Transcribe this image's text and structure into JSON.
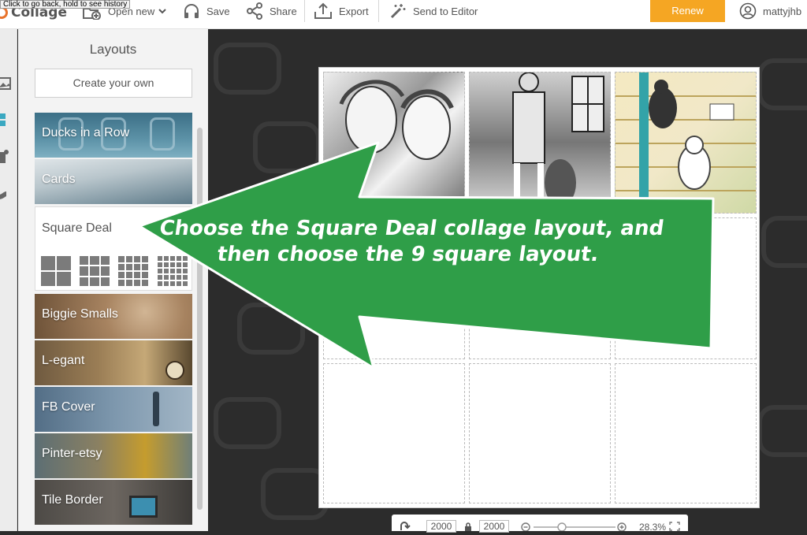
{
  "tooltip": "Click to go back, hold to see history",
  "app": {
    "logo_text": "Collage"
  },
  "toolbar": {
    "open_new": "Open new",
    "save": "Save",
    "share": "Share",
    "export": "Export",
    "send_to_editor": "Send to Editor",
    "renew": "Renew",
    "username": "mattyjhb"
  },
  "sidebar": {
    "title": "Layouts",
    "create_button": "Create your own",
    "layouts": [
      {
        "label": "Ducks in a Row"
      },
      {
        "label": "Cards"
      },
      {
        "label": "Square Deal"
      },
      {
        "label": "Biggie Smalls"
      },
      {
        "label": "L-egant"
      },
      {
        "label": "FB Cover"
      },
      {
        "label": "Pinter-etsy"
      },
      {
        "label": "Tile Border"
      }
    ],
    "square_deal_options": [
      "2x2",
      "3x3",
      "4x4",
      "5x5"
    ]
  },
  "bottom_bar": {
    "width": "2000",
    "height": "2000",
    "zoom": "28.3%"
  },
  "annotation": {
    "line1": "Choose the Square Deal collage layout, and",
    "line2": "then choose the 9 square layout."
  },
  "colors": {
    "arrow": "#2f9e48",
    "accent": "#f5a623",
    "logo": "#e8732c"
  }
}
